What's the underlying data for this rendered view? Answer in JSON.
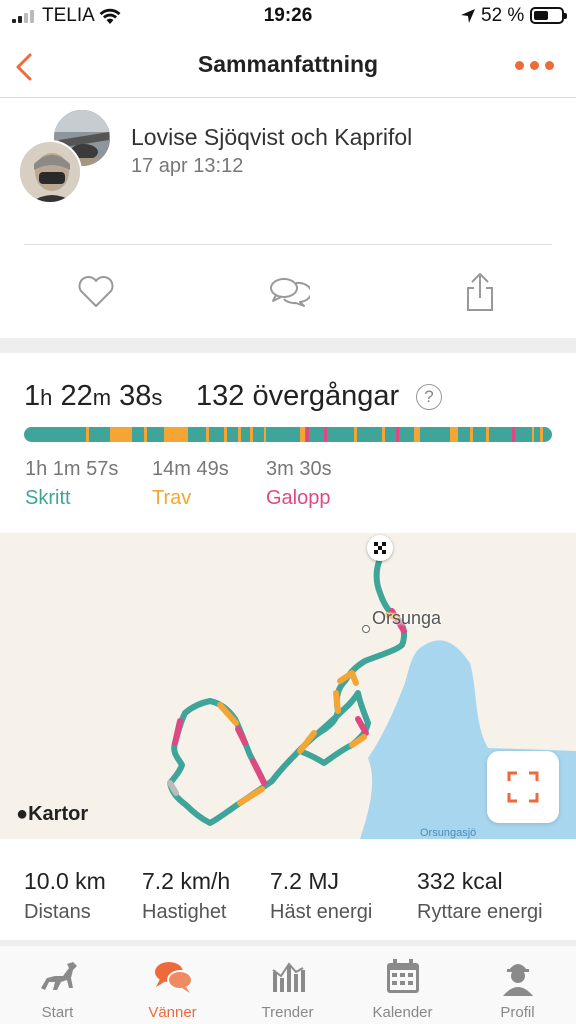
{
  "status_bar": {
    "carrier": "TELIA",
    "time": "19:26",
    "battery": "52 %"
  },
  "header": {
    "title": "Sammanfattning",
    "back_icon": "chevron-left-icon",
    "more_icon": "more-dots-icon"
  },
  "post": {
    "rider": "Lovise Sjöqvist  och Kaprifol",
    "date": "17 apr 13:12"
  },
  "actions": {
    "like_icon": "heart-icon",
    "comment_icon": "comment-icon",
    "share_icon": "share-icon"
  },
  "summary": {
    "h": "1",
    "h_unit": "h",
    "m": "22",
    "m_unit": "m",
    "s": "38",
    "s_unit": "s",
    "transitions": "132 övergångar",
    "help": "?"
  },
  "gaits": [
    {
      "time": "1h 1m 57s",
      "name": "Skritt",
      "color": "#3ea597"
    },
    {
      "time": "14m 49s",
      "name": "Trav",
      "color": "#f5a534"
    },
    {
      "time": "3m 30s",
      "name": "Galopp",
      "color": "#e04882"
    }
  ],
  "map": {
    "town": "Orsunga",
    "lake": "Orsungasjö",
    "attribution": "Kartor",
    "water_color": "#a8d6ee"
  },
  "stats": [
    {
      "value": "10.0 km",
      "label": "Distans"
    },
    {
      "value": "7.2 km/h",
      "label": "Hastighet"
    },
    {
      "value": "7.2 MJ",
      "label": "Häst energi"
    },
    {
      "value": "332 kcal",
      "label": "Ryttare energi"
    }
  ],
  "tabs": [
    {
      "label": "Start",
      "icon": "horse-icon",
      "active": false
    },
    {
      "label": "Vänner",
      "icon": "chat-bubbles-icon",
      "active": true
    },
    {
      "label": "Trender",
      "icon": "bar-chart-icon",
      "active": false
    },
    {
      "label": "Kalender",
      "icon": "calendar-icon",
      "active": false
    },
    {
      "label": "Profil",
      "icon": "person-icon",
      "active": false
    }
  ]
}
